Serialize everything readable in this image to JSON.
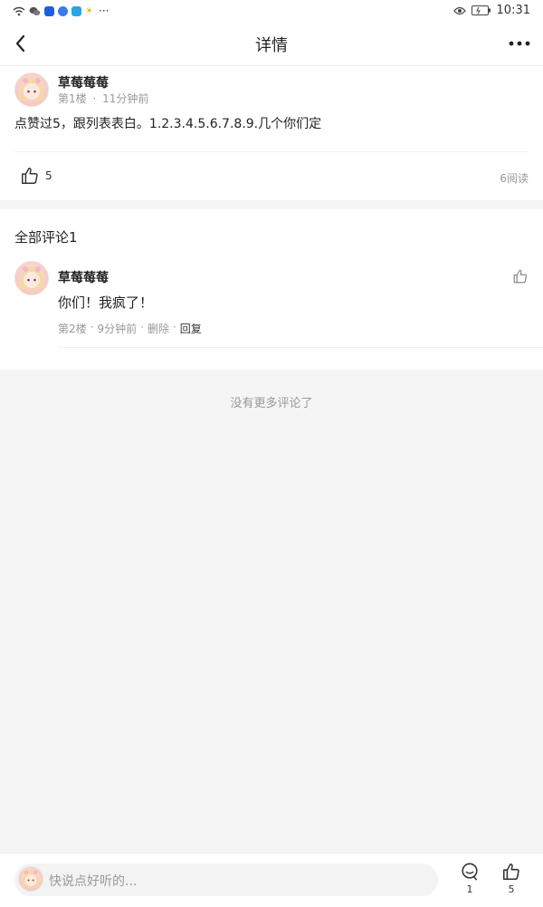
{
  "status_bar": {
    "time": "10:31",
    "overflow_dots": "···"
  },
  "nav": {
    "title": "详情"
  },
  "post": {
    "author": "草莓莓莓",
    "floor": "第1楼",
    "time": "11分钟前",
    "content": "点赞过5，跟列表表白。1.2.3.4.5.6.7.8.9.几个你们定",
    "like_count": "5",
    "read_count": "6阅读"
  },
  "comments": {
    "title": "全部评论1",
    "items": [
      {
        "author": "草莓莓莓",
        "text": "你们！我疯了！",
        "floor": "第2楼",
        "time": "9分钟前",
        "delete_label": "删除",
        "reply_label": "回复",
        "separator": "·"
      }
    ]
  },
  "no_more": "没有更多评论了",
  "bottom_bar": {
    "placeholder": "快说点好听的...",
    "comment_count": "1",
    "like_count": "5"
  },
  "colors": {
    "accent": "#222222",
    "muted": "#999999",
    "background": "#f5f5f5"
  }
}
